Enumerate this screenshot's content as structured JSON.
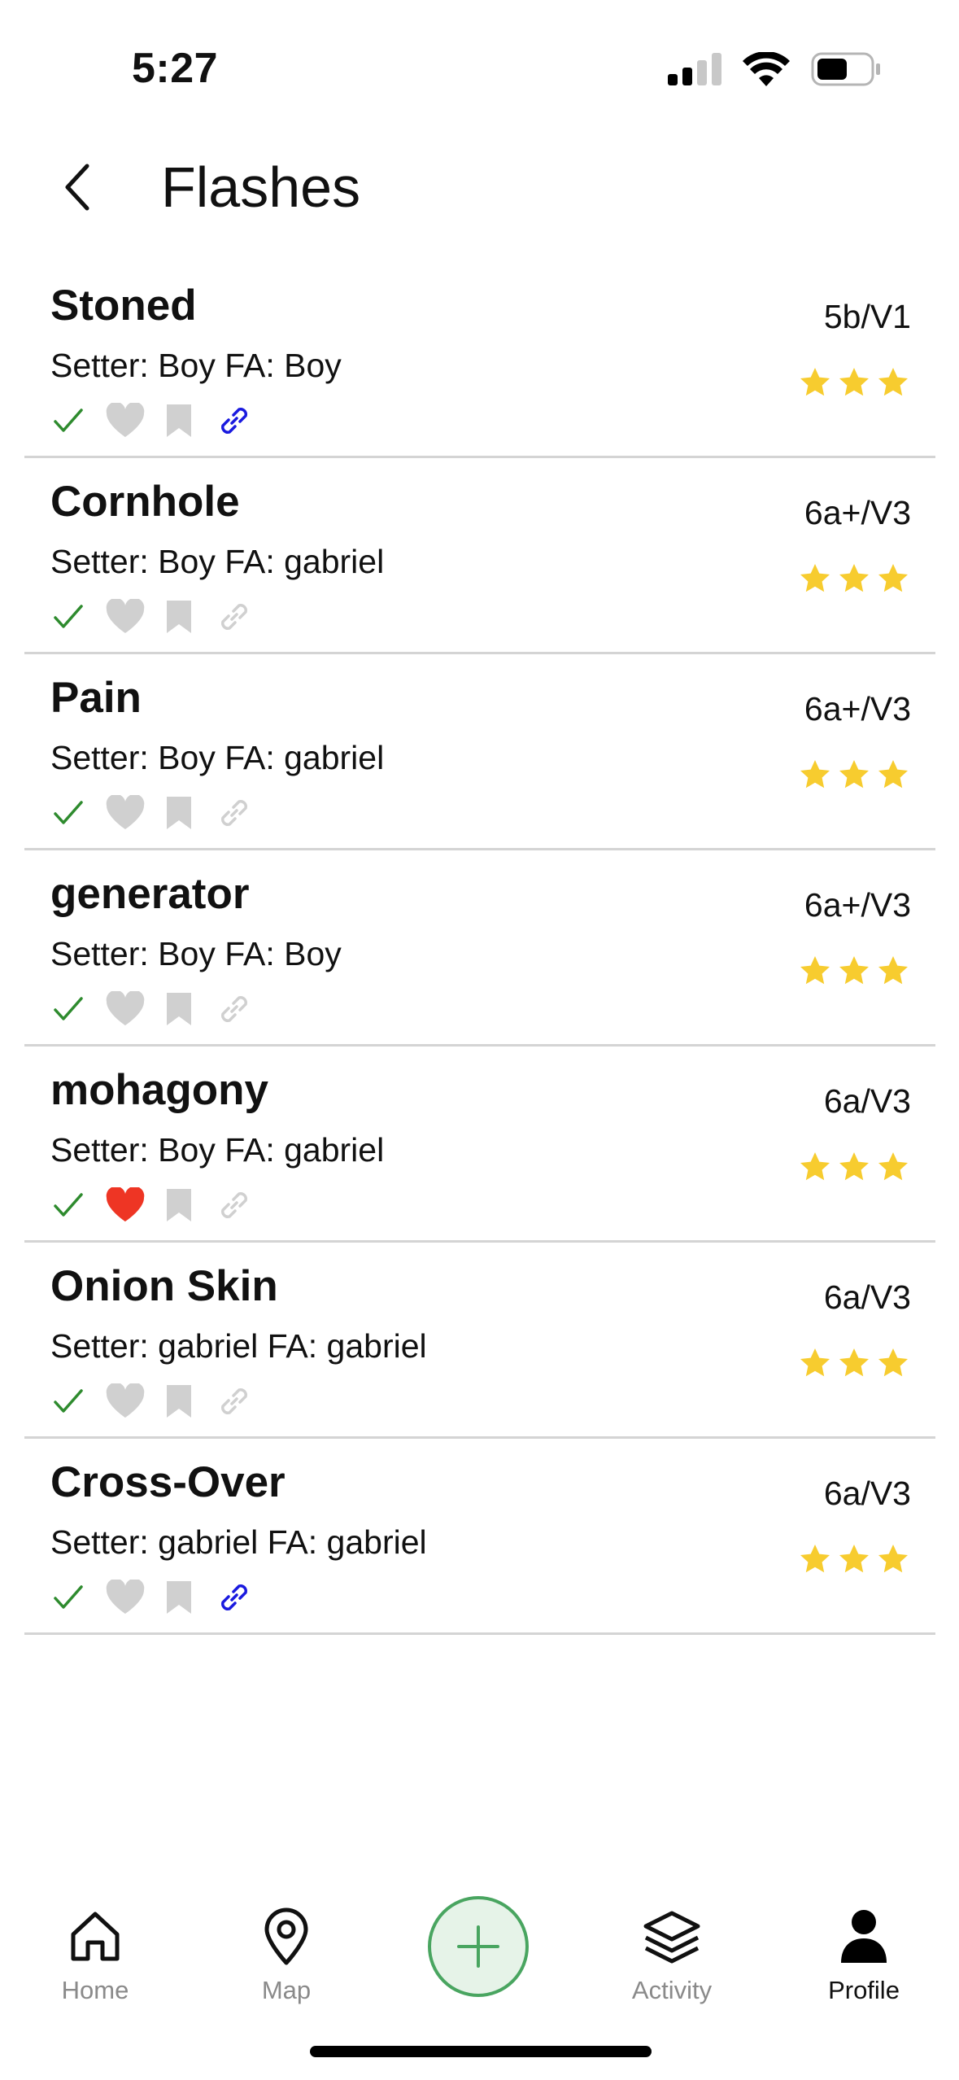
{
  "status": {
    "time": "5:27"
  },
  "header": {
    "title": "Flashes"
  },
  "routes": [
    {
      "name": "Stoned",
      "setter_line": "Setter: Boy FA: Boy",
      "grade": "5b/V1",
      "stars": 3,
      "sent": true,
      "liked": false,
      "bookmarked": false,
      "linked": true
    },
    {
      "name": "Cornhole",
      "setter_line": "Setter: Boy FA: gabriel",
      "grade": "6a+/V3",
      "stars": 3,
      "sent": true,
      "liked": false,
      "bookmarked": false,
      "linked": false
    },
    {
      "name": "Pain",
      "setter_line": "Setter: Boy FA: gabriel",
      "grade": "6a+/V3",
      "stars": 3,
      "sent": true,
      "liked": false,
      "bookmarked": false,
      "linked": false
    },
    {
      "name": "generator",
      "setter_line": "Setter: Boy FA: Boy",
      "grade": "6a+/V3",
      "stars": 3,
      "sent": true,
      "liked": false,
      "bookmarked": false,
      "linked": false
    },
    {
      "name": "mohagony",
      "setter_line": "Setter: Boy FA: gabriel",
      "grade": "6a/V3",
      "stars": 3,
      "sent": true,
      "liked": true,
      "bookmarked": false,
      "linked": false
    },
    {
      "name": "Onion Skin",
      "setter_line": "Setter: gabriel FA: gabriel",
      "grade": "6a/V3",
      "stars": 3,
      "sent": true,
      "liked": false,
      "bookmarked": false,
      "linked": false
    },
    {
      "name": "Cross-Over",
      "setter_line": "Setter: gabriel FA: gabriel",
      "grade": "6a/V3",
      "stars": 3,
      "sent": true,
      "liked": false,
      "bookmarked": false,
      "linked": true
    }
  ],
  "nav": {
    "home": "Home",
    "map": "Map",
    "activity": "Activity",
    "profile": "Profile",
    "active": "Profile"
  },
  "colors": {
    "check": "#2e8b2e",
    "heart_liked": "#ee3524",
    "icon_muted": "#d0d0d0",
    "link_active": "#1a1adf",
    "star": "#f7cc2f",
    "accent_green": "#49a560"
  }
}
